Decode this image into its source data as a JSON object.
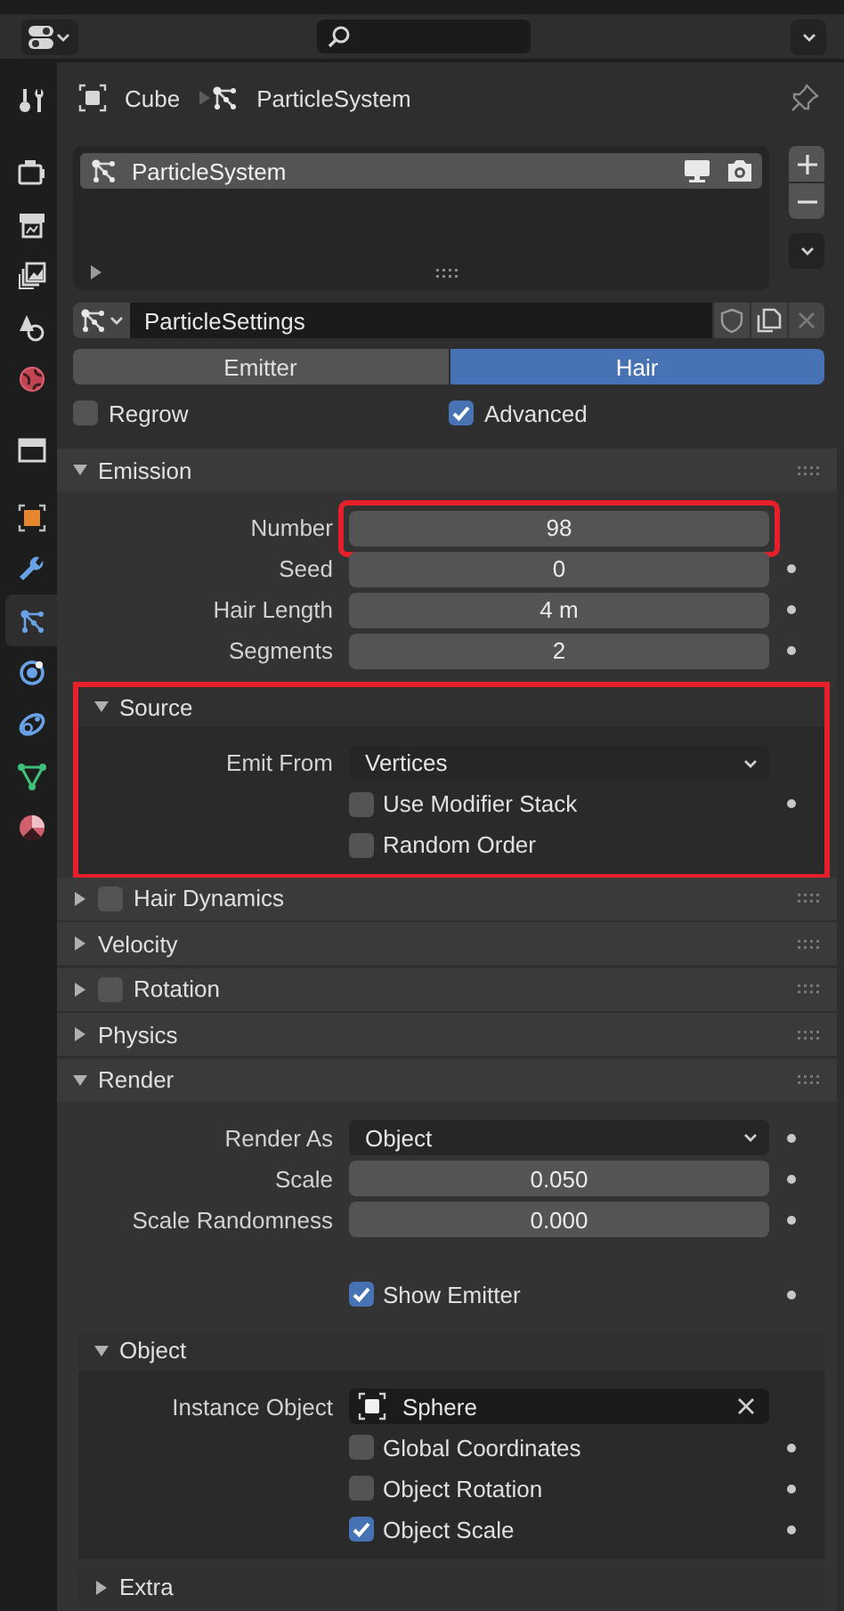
{
  "sidebar": {
    "tabs": [
      {
        "kind": "tool",
        "selected": false
      },
      {
        "kind": "render",
        "selected": false
      },
      {
        "kind": "output",
        "selected": false
      },
      {
        "kind": "view_layer",
        "selected": false
      },
      {
        "kind": "scene",
        "selected": false
      },
      {
        "kind": "world",
        "selected": false
      },
      {
        "kind": "collection",
        "selected": false
      },
      {
        "kind": "object",
        "selected": false
      },
      {
        "kind": "modifiers",
        "selected": false
      },
      {
        "kind": "particles",
        "selected": true
      },
      {
        "kind": "physics",
        "selected": false
      },
      {
        "kind": "constraints",
        "selected": false
      },
      {
        "kind": "data",
        "selected": false
      },
      {
        "kind": "material",
        "selected": false
      }
    ]
  },
  "breadcrumb": [
    {
      "kind": "object",
      "label": "Cube"
    },
    {
      "kind": "particles",
      "label": "ParticleSystem"
    }
  ],
  "particle_systems": [
    {
      "name": "ParticleSystem",
      "selected": true
    }
  ],
  "settings": {
    "name": "ParticleSettings"
  },
  "type_tabs": [
    {
      "label": "Emitter",
      "selected": false
    },
    {
      "label": "Hair",
      "selected": true
    }
  ],
  "toggles": [
    {
      "label": "Regrow",
      "checked": false
    },
    {
      "label": "Advanced",
      "checked": true
    }
  ],
  "panels": [
    {
      "title": "Emission",
      "expanded": true,
      "rows": [
        {
          "kind": "number",
          "label": "Number",
          "value": "98",
          "keyframe": false,
          "highlighted": true
        },
        {
          "kind": "number",
          "label": "Seed",
          "value": "0",
          "keyframe": true,
          "highlighted": false
        },
        {
          "kind": "number",
          "label": "Hair Length",
          "value": "4 m",
          "keyframe": true,
          "highlighted": false
        },
        {
          "kind": "number",
          "label": "Segments",
          "value": "2",
          "keyframe": true,
          "highlighted": false
        }
      ],
      "subpanels": [
        {
          "title": "Source",
          "expanded": true,
          "highlighted": true,
          "rows": [
            {
              "kind": "dropdown",
              "label": "Emit From",
              "value": "Vertices",
              "keyframe": false
            },
            {
              "kind": "checkbox",
              "label": "Use Modifier Stack",
              "checked": false,
              "keyframe": true
            },
            {
              "kind": "checkbox",
              "label": "Random Order",
              "checked": false,
              "keyframe": false
            }
          ]
        }
      ]
    },
    {
      "title": "Hair Dynamics",
      "expanded": false,
      "checked": false
    },
    {
      "title": "Velocity",
      "expanded": false
    },
    {
      "title": "Rotation",
      "expanded": false,
      "checked": false
    },
    {
      "title": "Physics",
      "expanded": false
    },
    {
      "title": "Render",
      "expanded": true,
      "rows": [
        {
          "kind": "dropdown",
          "label": "Render As",
          "value": "Object",
          "keyframe": true
        },
        {
          "kind": "number",
          "label": "Scale",
          "value": "0.050",
          "keyframe": true
        },
        {
          "kind": "number",
          "label": "Scale Randomness",
          "value": "0.000",
          "keyframe": true
        },
        {
          "kind": "checkbox",
          "label": "Show Emitter",
          "checked": true,
          "keyframe": true
        }
      ],
      "subpanels": [
        {
          "title": "Object",
          "expanded": true,
          "highlighted": false,
          "rows": [
            {
              "kind": "object",
              "label": "Instance Object",
              "value": "Sphere",
              "keyframe": false
            },
            {
              "kind": "checkbox",
              "label": "Global Coordinates",
              "checked": false,
              "keyframe": true
            },
            {
              "kind": "checkbox",
              "label": "Object Rotation",
              "checked": false,
              "keyframe": true
            },
            {
              "kind": "checkbox",
              "label": "Object Scale",
              "checked": true,
              "keyframe": true
            }
          ]
        },
        {
          "title": "Extra",
          "expanded": false,
          "highlighted": false
        }
      ]
    }
  ]
}
